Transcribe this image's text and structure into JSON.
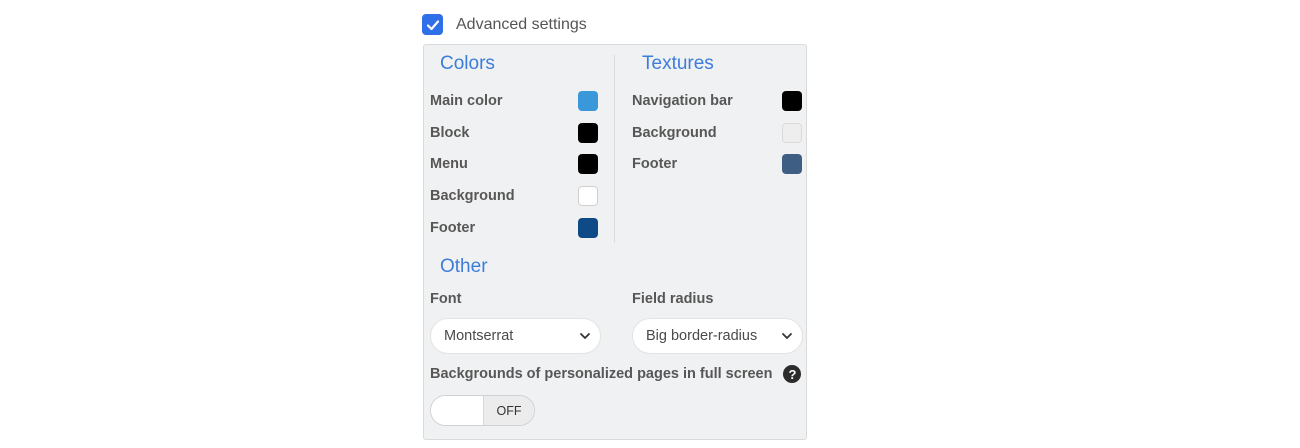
{
  "advanced": {
    "label": "Advanced settings",
    "checked": true
  },
  "colors": {
    "title": "Colors",
    "items": [
      {
        "label": "Main color",
        "color": "#3a97da"
      },
      {
        "label": "Block",
        "color": "#000000"
      },
      {
        "label": "Menu",
        "color": "#000000"
      },
      {
        "label": "Background",
        "color": "#ffffff"
      },
      {
        "label": "Footer",
        "color": "#0d4a86"
      }
    ]
  },
  "textures": {
    "title": "Textures",
    "items": [
      {
        "label": "Navigation bar",
        "color": "#000000"
      },
      {
        "label": "Background",
        "color": "#eeeeee"
      },
      {
        "label": "Footer",
        "color": "#3e5f83"
      }
    ]
  },
  "other": {
    "title": "Other",
    "font": {
      "label": "Font",
      "value": "Montserrat"
    },
    "field_radius": {
      "label": "Field radius",
      "value": "Big border-radius"
    },
    "fullscreen": {
      "label": "Backgrounds of personalized pages in full screen",
      "toggle_text": "OFF"
    }
  },
  "icons": {
    "check": "check-icon",
    "chevron": "chevron-down-icon",
    "help": "question-circle-icon"
  }
}
